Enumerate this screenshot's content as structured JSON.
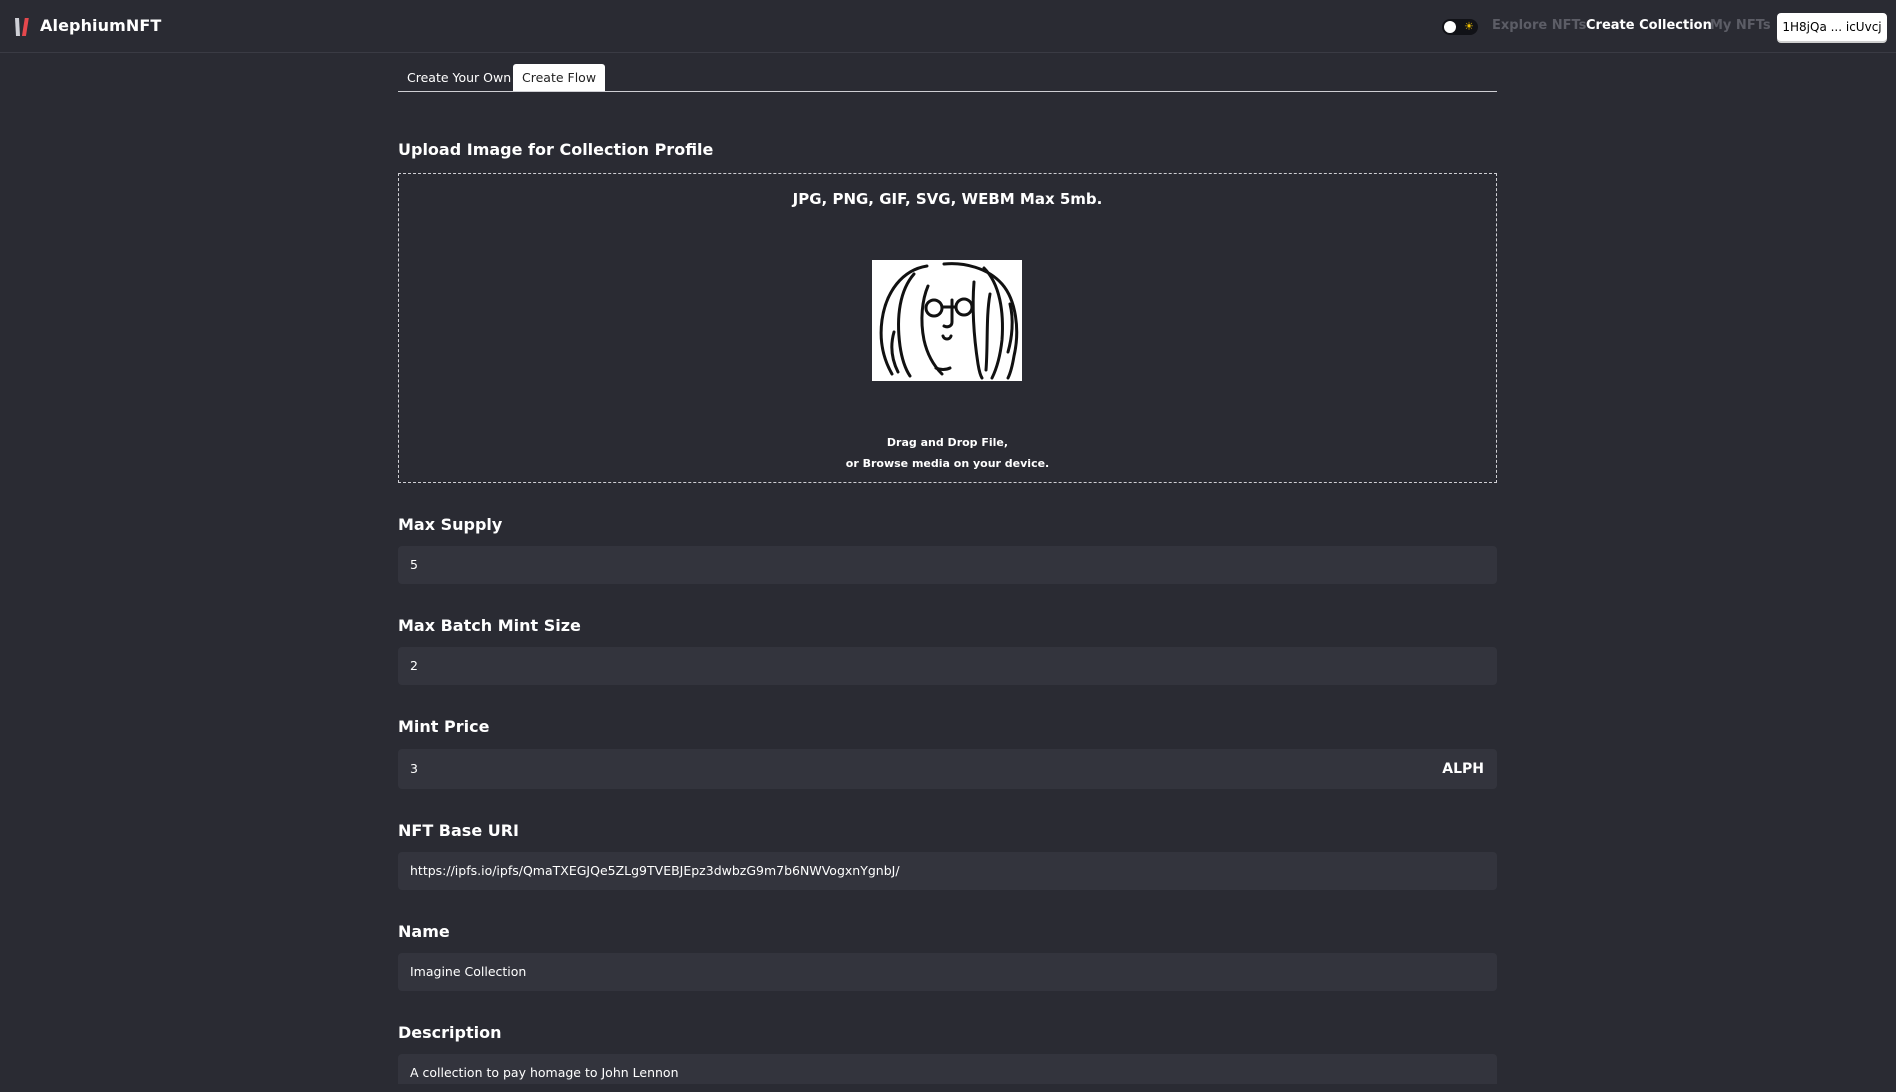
{
  "header": {
    "brand": "AlephiumNFT",
    "nav": {
      "explore": "Explore NFTs",
      "create": "Create Collection",
      "my_nfts": "My NFTs"
    },
    "wallet": "1H8jQa ... icUvcj",
    "theme_icon": "sun-icon"
  },
  "tabs": {
    "own": "Create Your Own",
    "flow": "Create Flow",
    "active": "Create Flow"
  },
  "upload": {
    "label": "Upload Image for Collection Profile",
    "formats": "JPG, PNG, GIF, SVG, WEBM Max 5mb.",
    "hint_line1": "Drag and Drop File,",
    "hint_line2": "or Browse media on your device.",
    "preview_icon": "line-drawing-face-image"
  },
  "fields": {
    "max_supply": {
      "label": "Max Supply",
      "value": "5"
    },
    "max_batch": {
      "label": "Max Batch Mint Size",
      "value": "2"
    },
    "mint_price": {
      "label": "Mint Price",
      "value": "3",
      "unit": "ALPH"
    },
    "base_uri": {
      "label": "NFT Base URI",
      "value": "https://ipfs.io/ipfs/QmaTXEGJQe5ZLg9TVEBJEpz3dwbzG9m7b6NWVogxnYgnbJ/"
    },
    "name": {
      "label": "Name",
      "value": "Imagine Collection"
    },
    "description": {
      "label": "Description",
      "value": "A collection to pay homage to John Lennon"
    }
  },
  "colors": {
    "background": "#2a2b33",
    "field": "#33343d",
    "muted_nav": "#5c5d66",
    "logo_red": "#e5484d"
  }
}
